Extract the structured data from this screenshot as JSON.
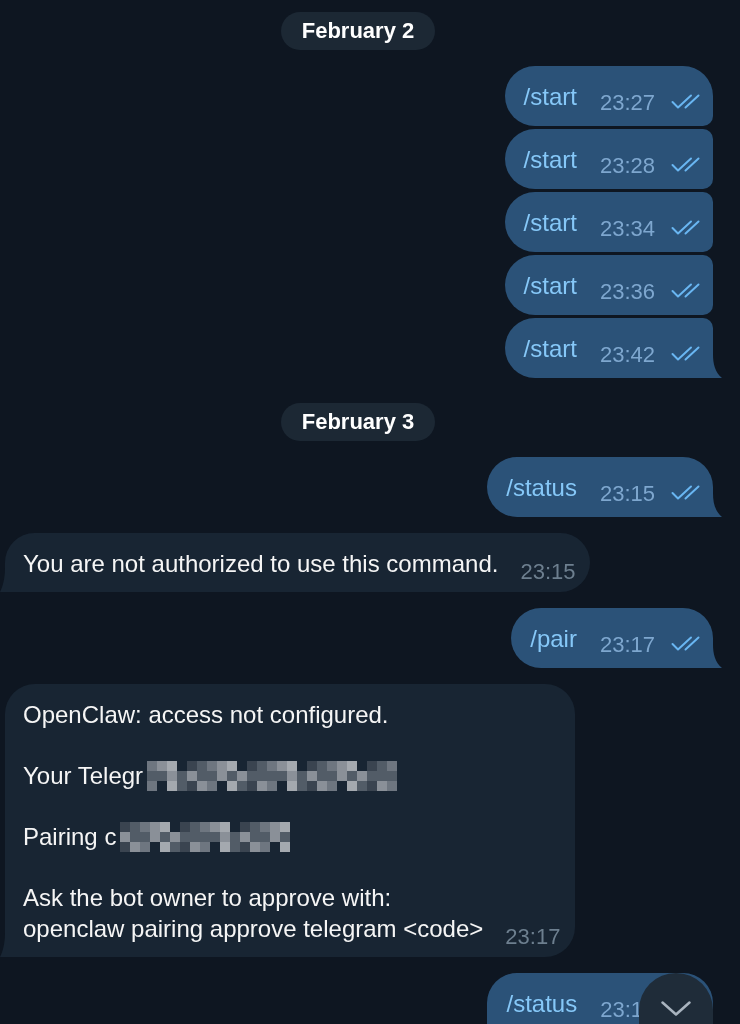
{
  "messages": [
    {
      "kind": "date",
      "text": "February 2"
    },
    {
      "kind": "outgoing",
      "text": "/start",
      "time": "23:27",
      "read": true
    },
    {
      "kind": "outgoing",
      "text": "/start",
      "time": "23:28",
      "read": true
    },
    {
      "kind": "outgoing",
      "text": "/start",
      "time": "23:34",
      "read": true
    },
    {
      "kind": "outgoing",
      "text": "/start",
      "time": "23:36",
      "read": true
    },
    {
      "kind": "outgoing",
      "text": "/start",
      "time": "23:42",
      "read": true
    },
    {
      "kind": "date",
      "text": "February 3"
    },
    {
      "kind": "outgoing",
      "text": "/status",
      "time": "23:15",
      "read": true
    },
    {
      "kind": "incoming",
      "paragraphs": [
        {
          "lines": [
            "You are not authorized to use this command."
          ],
          "redacted": false
        }
      ],
      "time": "23:15"
    },
    {
      "kind": "outgoing",
      "text": "/pair",
      "time": "23:17",
      "read": true
    },
    {
      "kind": "incoming",
      "paragraphs": [
        {
          "lines": [
            "OpenClaw: access not configured."
          ],
          "redacted": false
        },
        {
          "lines": [
            "Your Telegr"
          ],
          "redacted": true
        },
        {
          "lines": [
            "Pairing c"
          ],
          "redacted": true
        },
        {
          "lines": [
            "Ask the bot owner to approve with:",
            "openclaw pairing approve telegram <code>"
          ],
          "redacted": false
        }
      ],
      "time": "23:17"
    },
    {
      "kind": "outgoing",
      "text": "/status",
      "time": "23:1"
    }
  ]
}
